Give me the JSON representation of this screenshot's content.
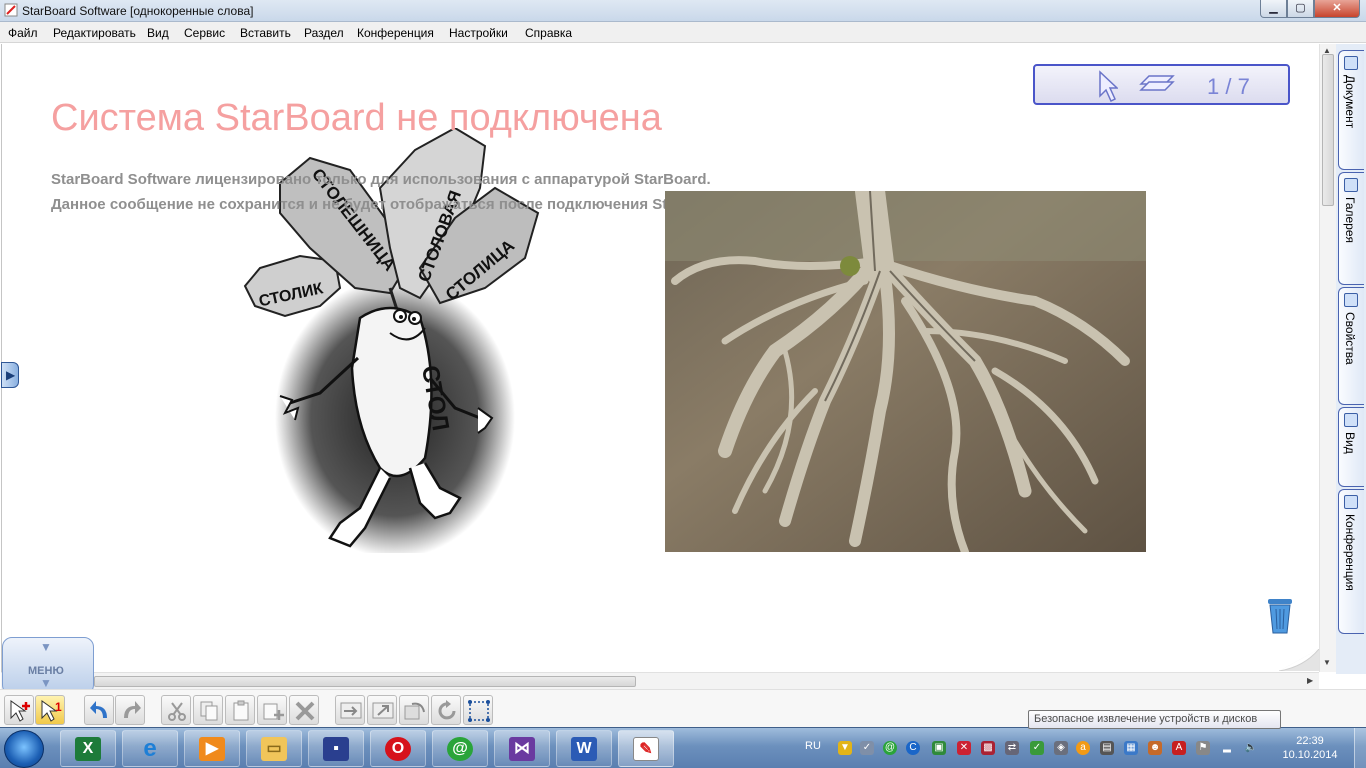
{
  "window": {
    "title": "StarBoard Software [однокоренные слова]",
    "buttons": {
      "minimize": "▁",
      "maximize": "▢",
      "close": "✕"
    }
  },
  "menubar": {
    "items": [
      "Файл",
      "Редактировать",
      "Вид",
      "Сервис",
      "Вставить",
      "Раздел",
      "Конференция",
      "Настройки",
      "Справка"
    ]
  },
  "canvas": {
    "heading": "Система StarBoard не подключена",
    "license_line1": "StarBoard Software лицензировано только для использования с аппаратурой StarBoard.",
    "license_line2": "Данное сообщение не сохранится и не будет отображаться после подключения StarBoard.",
    "cartoon": {
      "leaves": [
        "СТОЛИК",
        "СТОЛЕШНИЦА",
        "СТОЛОВАЯ",
        "СТОЛИЦА"
      ],
      "body": "СТОЛ"
    },
    "page_indicator": "1 / 7"
  },
  "side_tabs": [
    "Документ",
    "Галерея",
    "Свойства",
    "Вид",
    "Конференция"
  ],
  "menu_widget": {
    "label": "МЕНЮ"
  },
  "toolbar": {
    "buttons": [
      "select-add",
      "select-one",
      "undo",
      "redo",
      "cut",
      "copy",
      "paste",
      "paste-new",
      "delete",
      "import",
      "export",
      "send-back",
      "refresh",
      "select-area"
    ]
  },
  "taskbar": {
    "language": "RU",
    "time": "22:39",
    "date": "10.10.2014",
    "apps": [
      "excel",
      "internet-explorer",
      "media-player",
      "explorer",
      "save",
      "opera",
      "mail-agent",
      "visual-studio",
      "word",
      "starboard"
    ]
  },
  "tooltip": "Безопасное извлечение устройств и дисков",
  "colors": {
    "heading": "#f5a0a0",
    "license_text": "#8f8f8f",
    "page_nav_border": "#4a55c9",
    "taskbar": "#6c90bd"
  }
}
